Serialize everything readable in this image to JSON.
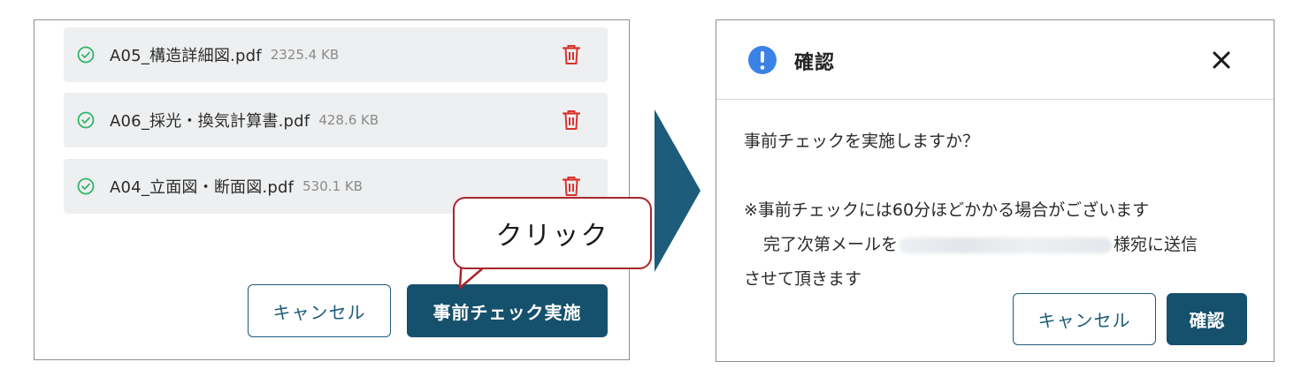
{
  "files": [
    {
      "name": "A05_構造詳細図.pdf",
      "size": "2325.4 KB"
    },
    {
      "name": "A06_採光・換気計算書.pdf",
      "size": "428.6 KB"
    },
    {
      "name": "A04_立面図・断面図.pdf",
      "size": "530.1 KB"
    }
  ],
  "left_buttons": {
    "cancel_label": "キャンセル",
    "precheck_label": "事前チェック実施"
  },
  "annotation": {
    "callout_text": "クリック"
  },
  "dialog": {
    "title": "確認",
    "question": "事前チェックを実施しますか？",
    "notice_line1": "※事前チェックには60分ほどかかる場合がございます",
    "notice_line2_prefix": "完了次第メールを",
    "notice_line2_suffix": "様宛に送信",
    "notice_line3": "させて頂きます",
    "cancel_label": "キャンセル",
    "confirm_label": "確認"
  },
  "colors": {
    "primary": "#15506c",
    "success": "#2fb56a",
    "danger": "#d9322e",
    "info": "#3b82e6",
    "callout_border": "#a9262a",
    "arrow": "#1d5c7a"
  },
  "icons": [
    "check-circle-icon",
    "trash-icon",
    "info-icon",
    "close-icon",
    "arrow-right-icon"
  ]
}
